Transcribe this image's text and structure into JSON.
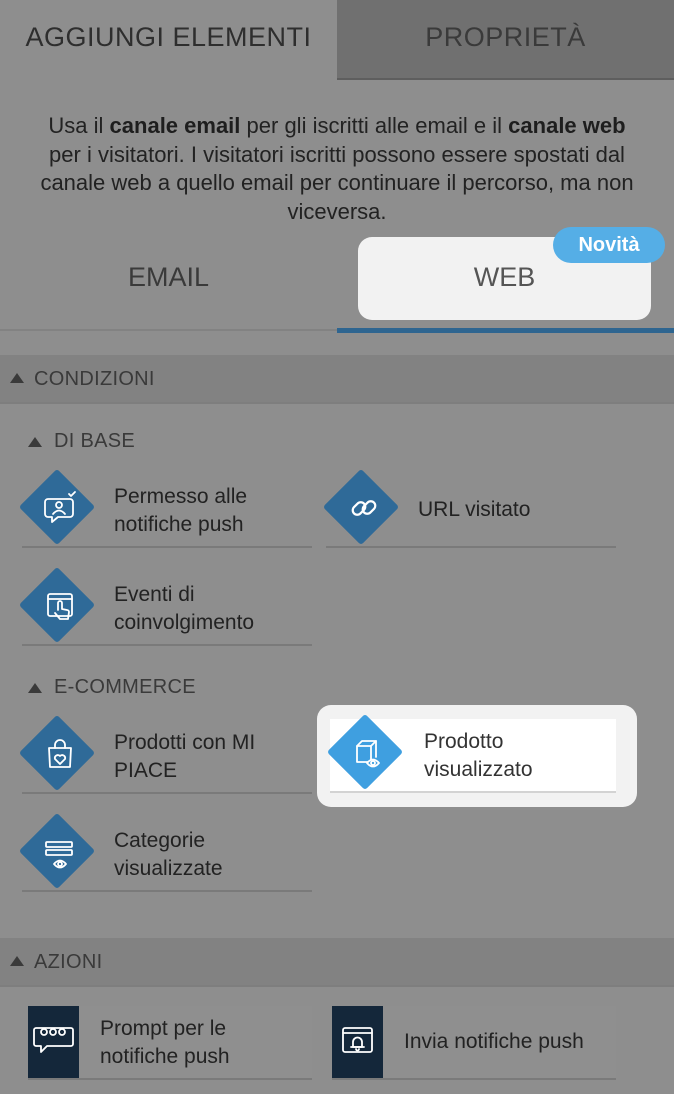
{
  "tabs": {
    "add_elements": "AGGIUNGI ELEMENTI",
    "properties": "PROPRIETÀ"
  },
  "info": {
    "part1": "Usa il ",
    "bold1": "canale email",
    "part2": " per gli iscritti alle email e il ",
    "bold2": "canale web",
    "part3": " per i visitatori. I visitatori iscritti possono essere spostati dal canale web a quello email per continuare il percorso, ma non viceversa."
  },
  "channels": {
    "email": "EMAIL",
    "web": "WEB",
    "badge": "Novità"
  },
  "sections": {
    "conditions": "CONDIZIONI",
    "basic": "DI BASE",
    "ecommerce": "E-COMMERCE",
    "actions": "AZIONI"
  },
  "basic_items": [
    {
      "line1": "Permesso alle",
      "line2": "notifiche push",
      "icon": "chat-user-check-icon"
    },
    {
      "line1": "URL visitato",
      "line2": "",
      "icon": "link-icon"
    },
    {
      "line1": "Eventi di",
      "line2": "coinvolgimento",
      "icon": "tap-hand-icon"
    }
  ],
  "ecommerce_items": [
    {
      "line1": "Prodotti con MI",
      "line2": "PIACE",
      "icon": "bag-heart-icon"
    },
    {
      "line1": "Prodotto",
      "line2": "visualizzato",
      "icon": "box-eye-icon"
    },
    {
      "line1": "Categorie",
      "line2": "visualizzate",
      "icon": "list-eye-icon"
    }
  ],
  "action_items": [
    {
      "line1": "Prompt per le",
      "line2": "notifiche push",
      "icon": "chat-dots-icon"
    },
    {
      "line1": "Invia notifiche push",
      "line2": "",
      "icon": "browser-bell-icon"
    }
  ],
  "colors": {
    "accent": "#2e6590",
    "badge": "#55aee6",
    "diamond": "#2f6a98",
    "diamond_highlight": "#3f9fe0",
    "action_icon_bg": "#14273a"
  }
}
